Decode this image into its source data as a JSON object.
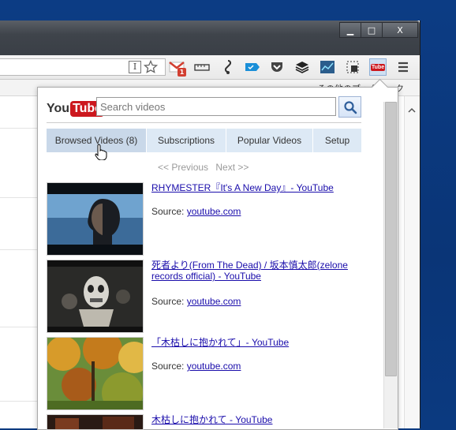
{
  "window": {
    "minimize_glyph": "▁",
    "maximize_glyph": "□",
    "close_glyph": "X"
  },
  "bookmarks": {
    "folder_label": "その他のブックマーク"
  },
  "popup": {
    "logo_you": "You",
    "logo_tube": "Tube",
    "logo_tm": "™",
    "search_placeholder": "Search videos",
    "tabs": [
      {
        "label": "Browsed Videos (8)",
        "active": true
      },
      {
        "label": "Subscriptions",
        "active": false
      },
      {
        "label": "Popular Videos",
        "active": false
      },
      {
        "label": "Setup",
        "active": false
      }
    ],
    "pager": {
      "previous": "<< Previous",
      "next": "Next >>"
    },
    "source_label": "Source:",
    "videos": [
      {
        "title": "RHYMESTER『It's A New Day』- YouTube",
        "source": "youtube.com"
      },
      {
        "title": "死者より(From The Dead) / 坂本慎太郎(zelone records official) - YouTube",
        "source": "youtube.com"
      },
      {
        "title": "「木枯しに抱かれて」- YouTube",
        "source": "youtube.com"
      },
      {
        "title": "木枯しに抱かれて - YouTube"
      }
    ]
  },
  "extensions": {
    "gmail_badge": "1",
    "reader_icon_text": "I",
    "youtube_icon_text": "Tube"
  },
  "colors": {
    "desktop": "#0b3a80",
    "youtube_red": "#cc181e",
    "link": "#1a0dab",
    "tab_bg": "#dde9f5"
  }
}
